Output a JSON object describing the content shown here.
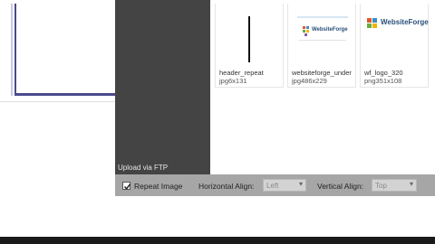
{
  "sidebar": {
    "upload_ftp_label": "Upload via FTP"
  },
  "gallery": {
    "items": [
      {
        "name": "header_repeat",
        "meta": "jpg6x131"
      },
      {
        "name": "websiteforge_under",
        "meta": "jpg486x229",
        "logo_text": "WebsiteForge"
      },
      {
        "name": "wf_logo_320",
        "meta": "png351x108",
        "logo_text": "WebsiteForge"
      }
    ]
  },
  "toolbar": {
    "repeat_label": "Repeat Image",
    "repeat_checked": true,
    "h_align_label": "Horizontal Align:",
    "h_align_value": "Left",
    "v_align_label": "Vertical Align:",
    "v_align_value": "Top"
  },
  "colors": {
    "sidebar_bg": "#444444",
    "toolbar_bg": "#a6a6a6",
    "frame_border": "#4b4a8c"
  }
}
